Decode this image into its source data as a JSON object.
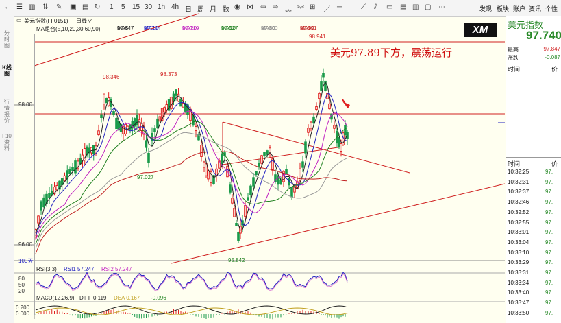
{
  "toolbar": {
    "icons": [
      "back-icon",
      "list-icon",
      "candles-icon",
      "trend-icon",
      "draw-icon",
      "save-icon",
      "refresh-icon"
    ],
    "periods": [
      "1",
      "5",
      "15",
      "30",
      "1h",
      "4h",
      "日",
      "周",
      "月"
    ],
    "tools": [
      "数",
      "◇",
      "◁",
      "◁",
      "◁",
      "◇",
      "◁",
      "⊞",
      "／",
      "─",
      "│",
      "⟋",
      "⟋",
      "▭",
      "▭",
      "▭"
    ],
    "right_links": [
      "发现",
      "板块",
      "账户",
      "资讯",
      "个性"
    ]
  },
  "left_tabs": [
    "分时图",
    "K线图",
    "行情报价",
    "F10资料"
  ],
  "title": {
    "name": "美元指数(FI 0151)",
    "period": "日线"
  },
  "ma": [
    {
      "label": "MA组合(5,10,20,30,60,90)",
      "value": "",
      "color": "#222"
    },
    {
      "label": "MA5",
      "value": "97.647",
      "color": "#222"
    },
    {
      "label": "MA10",
      "value": "97.744",
      "color": "#2020c0"
    },
    {
      "label": "MA20",
      "value": "97.719",
      "color": "#c020c0"
    },
    {
      "label": "MA30",
      "value": "97.527",
      "color": "#208020"
    },
    {
      "label": "MA60",
      "value": "97.300",
      "color": "#888888"
    },
    {
      "label": "MA90",
      "value": "97.391",
      "color": "#c02020"
    }
  ],
  "price_labels": {
    "high1": "98.346",
    "high2": "98.373",
    "low1": "97.027",
    "peak": "98.941",
    "bottom": "95.842"
  },
  "y_axis": {
    "top": "98.00",
    "bottom": "96.00",
    "small": "100天"
  },
  "annotation": "美元97.89下方，震荡运行",
  "rsi": {
    "title": "RSI(3,3)",
    "rsi1": "RSI1 57.247",
    "rsi2": "RSI2 57.247",
    "ticks": [
      "80",
      "50",
      "20"
    ]
  },
  "macd": {
    "title": "MACD(12,26,9)",
    "diff": "DIFF 0.119",
    "dea": "DEA 0.167",
    "macd": "-0.096",
    "ticks": [
      "0.200",
      "0.000"
    ]
  },
  "right_panel": {
    "name": "美元指数",
    "price": "97.740",
    "high_label": "最高",
    "high": "97.847",
    "chg_label": "涨跌",
    "chg": "-0.087",
    "time_header": "时间",
    "price_header": "价",
    "ticks": [
      {
        "t": "10:32:25",
        "p": "97."
      },
      {
        "t": "10:32:31",
        "p": "97."
      },
      {
        "t": "10:32:37",
        "p": "97."
      },
      {
        "t": "10:32:46",
        "p": "97."
      },
      {
        "t": "10:32:52",
        "p": "97."
      },
      {
        "t": "10:32:55",
        "p": "97."
      },
      {
        "t": "10:33:01",
        "p": "97."
      },
      {
        "t": "10:33:04",
        "p": "97."
      },
      {
        "t": "10:33:10",
        "p": "97."
      },
      {
        "t": "10:33:29",
        "p": "97."
      },
      {
        "t": "10:33:31",
        "p": "97."
      },
      {
        "t": "10:33:34",
        "p": "97."
      },
      {
        "t": "10:33:40",
        "p": "97."
      },
      {
        "t": "10:33:47",
        "p": "97."
      },
      {
        "t": "10:33:50",
        "p": "97."
      }
    ]
  },
  "logo": "XM"
}
